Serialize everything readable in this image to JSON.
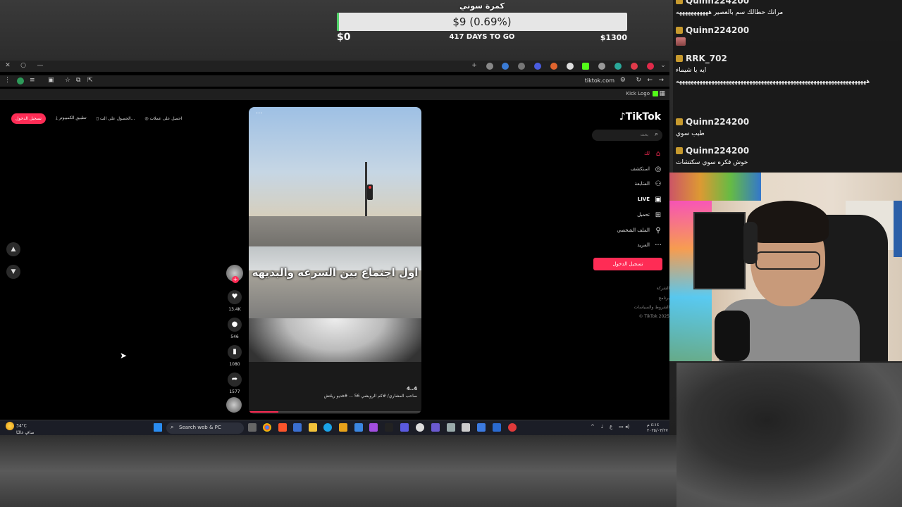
{
  "goal": {
    "title": "كمرة سوني",
    "bar_text": "$9 (0.69%)",
    "progress": 0.0069,
    "min": "$0",
    "days": "417 DAYS TO GO",
    "max": "$1300"
  },
  "browser": {
    "url": "tiktok.com",
    "bookmark": "Kick Logo"
  },
  "tiktok": {
    "actions": [
      {
        "label": "احصل على عملات"
      },
      {
        "label": "الحصول على الت..."
      },
      {
        "label": "تطبيق الكمبيوتر"
      }
    ],
    "login_pill": "تسجيل الدخول",
    "logo": "TikTok",
    "search_placeholder": "بحث",
    "nav": [
      {
        "label": "لك",
        "icon": "home-icon",
        "active": true
      },
      {
        "label": "استكشف",
        "icon": "compass-icon"
      },
      {
        "label": "المتابعة",
        "icon": "following-icon"
      },
      {
        "label": "LIVE",
        "icon": "live-icon"
      },
      {
        "label": "تحميل",
        "icon": "upload-icon"
      },
      {
        "label": "الملف الشخصي",
        "icon": "profile-icon"
      },
      {
        "label": "المزيد",
        "icon": "more-icon"
      }
    ],
    "login_button": "تسجيل الدخول",
    "footer": [
      "الشركة",
      "برنامج",
      "الشروط والسياسات",
      "© TikTok 2025"
    ],
    "video": {
      "caption": "اول اجتماع بين السرعه والبديهه",
      "handle": "4..4",
      "description": "صاحب المشاري/ #كم الرويشي 56 ... #فديو ريلتش",
      "progress": 0.17
    },
    "counts": {
      "likes": "13.4K",
      "comments": "546",
      "saves": "1080",
      "shares": "1577"
    }
  },
  "taskbar": {
    "weather_temp": "34°C",
    "weather_desc": "صافٍ غالبًا",
    "search": "Search web & PC",
    "lang": "ع",
    "time": "٤:١٤ م",
    "date": "٢٠٢٥/٠٣/٢٧"
  },
  "chat": [
    {
      "user": "Quinn224200",
      "text": "مراتك حطالك سم بالعصير هههههههههههه"
    },
    {
      "user": "Quinn224200",
      "text": "",
      "emote": true
    },
    {
      "user": "RRK_702",
      "text": "ايه يا شيماء",
      "text2": "هههههههههههههههههههههههههههههههههههههههههههههههههههههههههههههههههه"
    },
    {
      "user": "Quinn224200",
      "text": "طيب سوي"
    },
    {
      "user": "Quinn224200",
      "text": "خوش فكره سوي سكتشات"
    }
  ],
  "colors": {
    "accent": "#fe2c55",
    "goal_fill": "#53d36b",
    "badge": "#c79a2e"
  }
}
